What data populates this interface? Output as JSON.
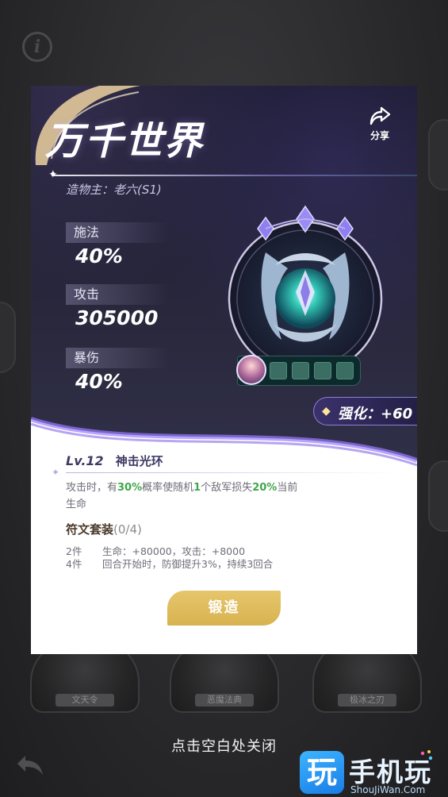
{
  "background": {
    "cards": [
      {
        "label": "文天令"
      },
      {
        "label": "恶魔法典"
      },
      {
        "label": "极冰之刃"
      }
    ],
    "close_hint": "点击空白处关闭"
  },
  "watermark": {
    "logo_char": "玩",
    "name": "手机玩",
    "url": "ShouJiWan.Com"
  },
  "artifact": {
    "title": "万千世界",
    "share_label": "分享",
    "creator": "造物主：老六(S1)",
    "stats": [
      {
        "label": "施法",
        "value": "40%"
      },
      {
        "label": "攻击",
        "value": "305000"
      },
      {
        "label": "暴伤",
        "value": "40%"
      }
    ],
    "enhance": "强化：+60",
    "rune_slots_filled": 0,
    "rune_slots_total": 4
  },
  "skill": {
    "level": "Lv.12",
    "name": "神击光环",
    "desc_parts": [
      "攻击时，有",
      "30%",
      "概率使随机",
      "1",
      "个敌军损失",
      "20%",
      "当前生命"
    ]
  },
  "rune_set": {
    "title": "符文套装",
    "count": "(0/4)",
    "rows": [
      {
        "tier": "2件",
        "text": "生命：+80000，攻击：+8000"
      },
      {
        "tier": "4件",
        "text": "回合开始时，防御提升3%，持续3回合"
      }
    ]
  },
  "forge_button": "锻造",
  "colors": {
    "accent_gold": "#d8b250",
    "highlight_green": "#3fa64a",
    "panel_dark": "#232237"
  }
}
